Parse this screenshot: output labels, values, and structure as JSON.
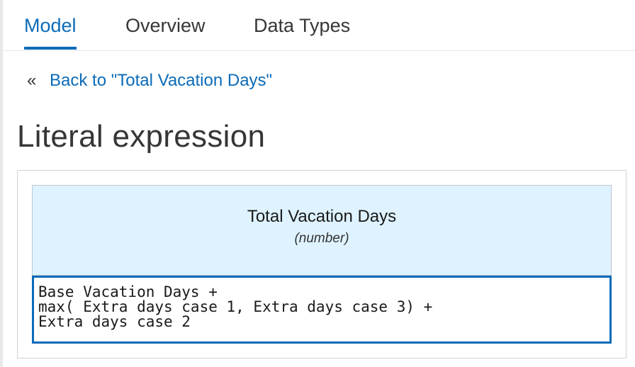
{
  "tabs": [
    {
      "label": "Model",
      "active": true
    },
    {
      "label": "Overview",
      "active": false
    },
    {
      "label": "Data Types",
      "active": false
    }
  ],
  "back": {
    "icon": "double-chevron-left-icon",
    "glyph": "«",
    "label": "Back to \"Total Vacation Days\""
  },
  "page_title": "Literal expression",
  "expression": {
    "name": "Total Vacation Days",
    "type": "(number)",
    "text": "Base Vacation Days +\nmax( Extra days case 1, Extra days case 3) +\nExtra days case 2"
  },
  "colors": {
    "accent": "#0b6bb8",
    "header_bg": "#def3ff"
  }
}
